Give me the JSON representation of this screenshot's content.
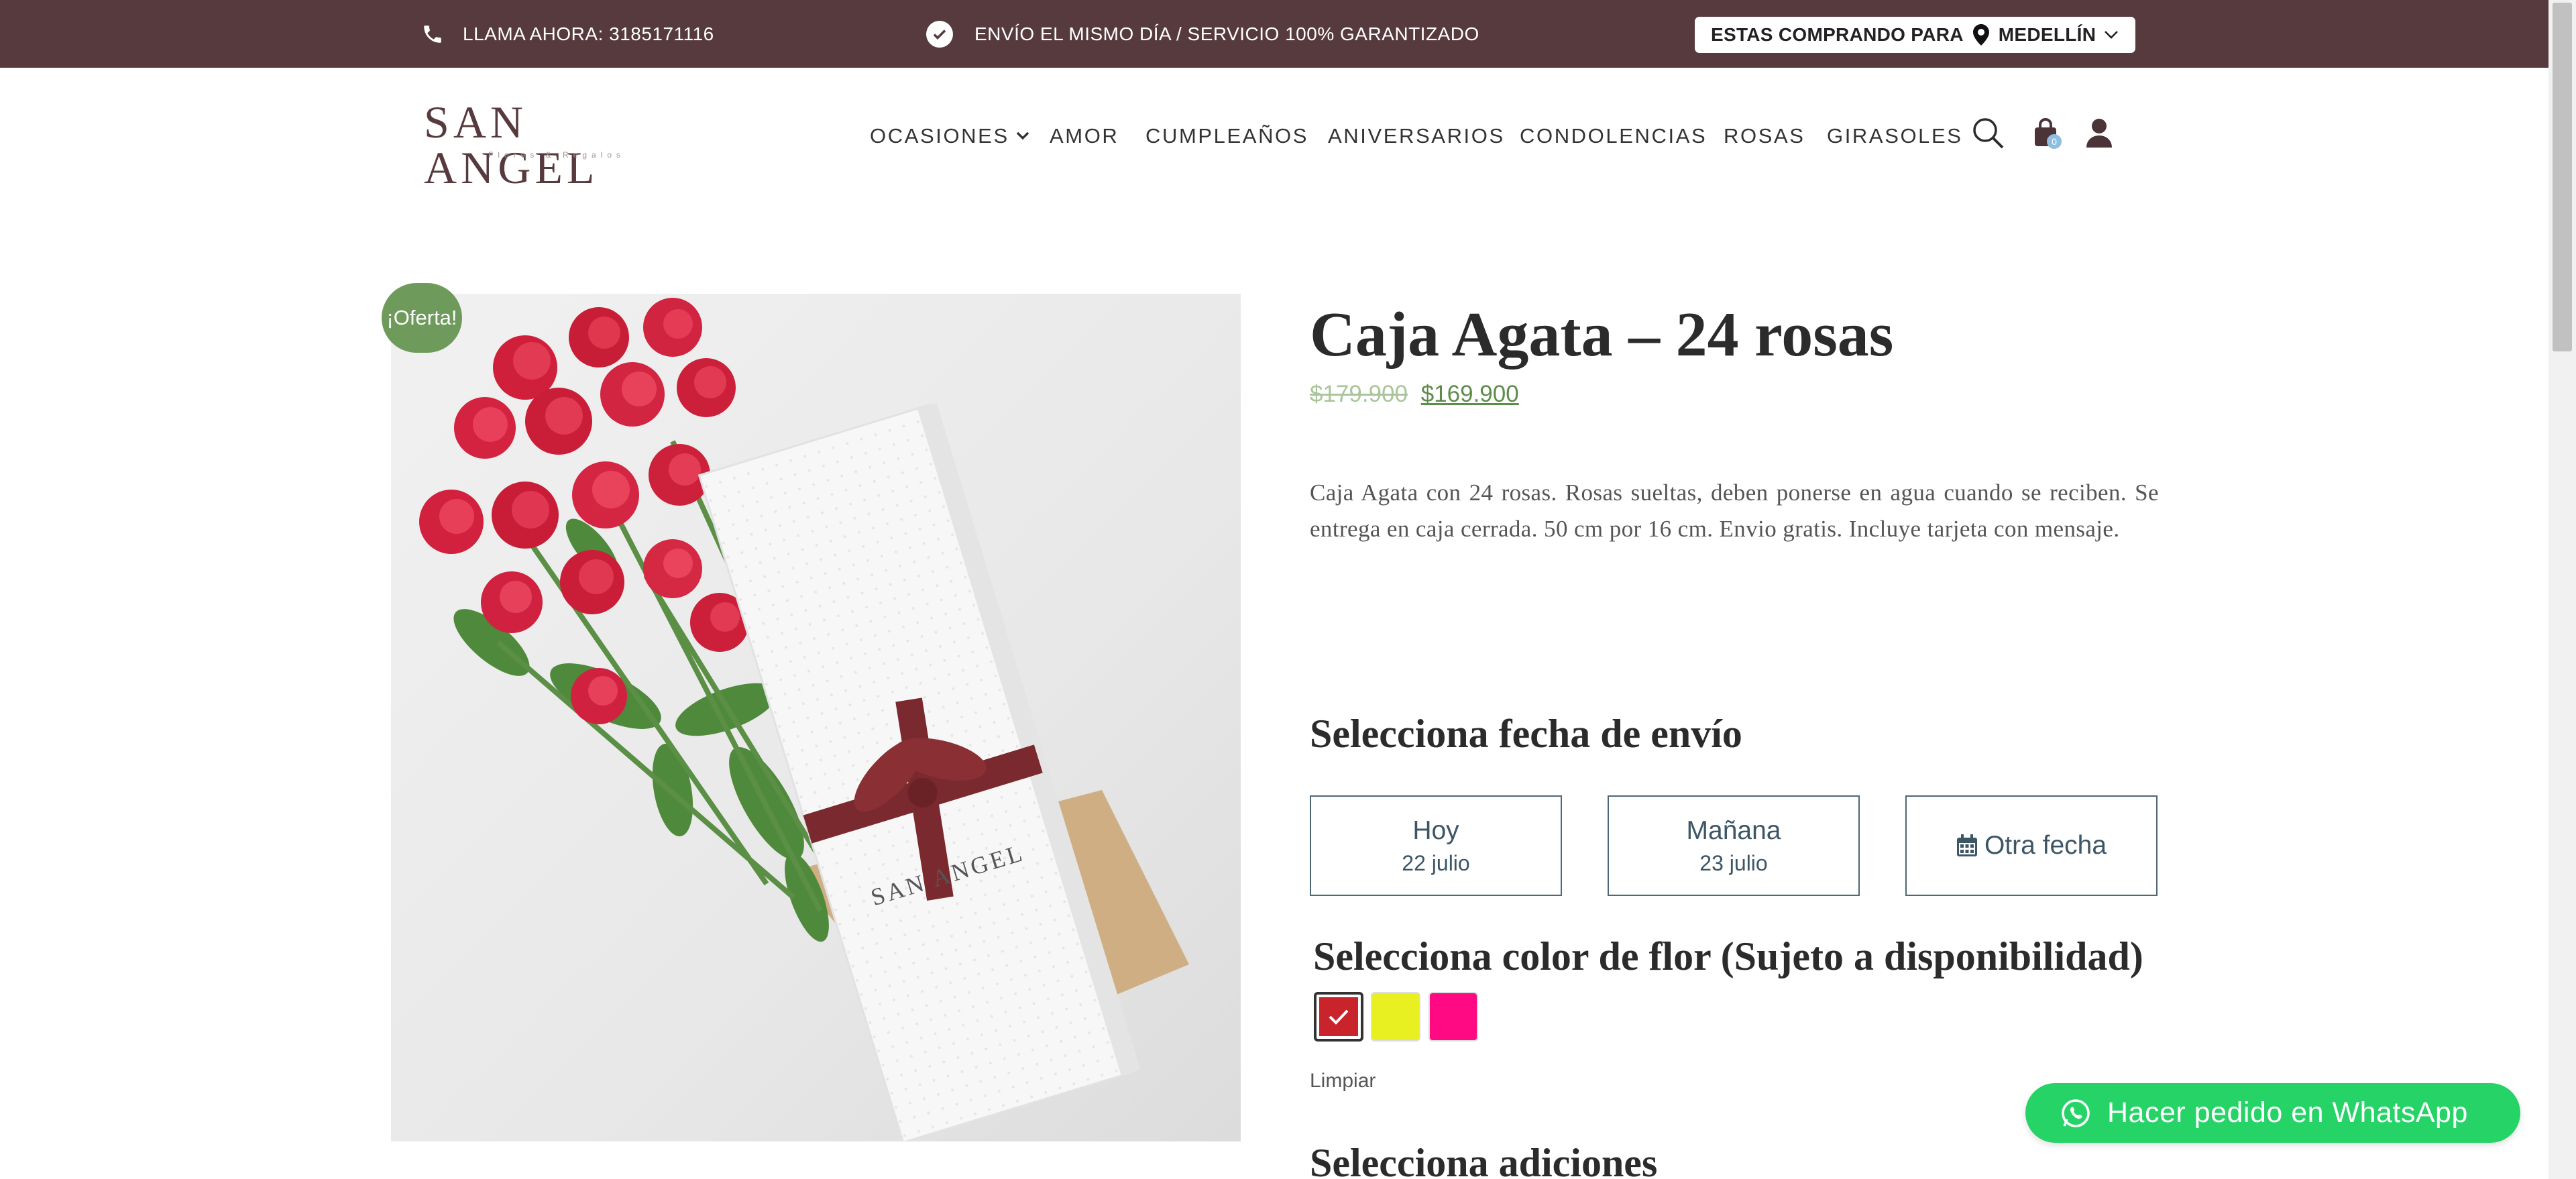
{
  "topbar": {
    "phone_text": "LLAMA AHORA: 3185171116",
    "shipping_text": "ENVÍO EL MISMO DÍA / SERVICIO 100% GARANTIZADO",
    "city_prefix": "ESTAS COMPRANDO PARA",
    "city": "MEDELLÍN",
    "bg_color": "#573A3D"
  },
  "header": {
    "logo_text": "SAN ANGEL",
    "logo_sub": "Flores & Regalos",
    "nav": [
      {
        "label": "OCASIONES"
      },
      {
        "label": "AMOR"
      },
      {
        "label": "CUMPLEAÑOS"
      },
      {
        "label": "ANIVERSARIOS"
      },
      {
        "label": "CONDOLENCIAS"
      },
      {
        "label": "ROSAS"
      },
      {
        "label": "GIRASOLES"
      }
    ],
    "cart_count": "0",
    "icons": [
      "search-icon",
      "shopping-bag-icon",
      "user-icon"
    ]
  },
  "product": {
    "sale_badge": "¡Oferta!",
    "title": "Caja Agata – 24 rosas",
    "old_price": "$179.900",
    "new_price": "$169.900",
    "description": "Caja Agata con 24 rosas. Rosas sueltas, deben ponerse en agua cuando se reciben. Se entrega en caja cerrada. 50 cm por 16 cm. Envio gratis. Incluye tarjeta con mensaje.",
    "box_brand": "SAN ANGEL"
  },
  "shipping_date": {
    "heading": "Selecciona fecha de envío",
    "options": [
      {
        "label": "Hoy",
        "date": "22 julio"
      },
      {
        "label": "Mañana",
        "date": "23 julio"
      },
      {
        "label": "Otra fecha"
      }
    ]
  },
  "flower_color": {
    "heading": "Selecciona color de flor (Sujeto a disponibilidad)",
    "swatches": [
      {
        "name": "rojo",
        "color": "#C9242B",
        "selected": true
      },
      {
        "name": "amarillo",
        "color": "#E8F021",
        "selected": false
      },
      {
        "name": "fucsia",
        "color": "#FF0A82",
        "selected": false
      }
    ],
    "clear_label": "Limpiar"
  },
  "additions": {
    "heading": "Selecciona adiciones"
  },
  "whatsapp": {
    "label": "Hacer pedido en WhatsApp",
    "color": "#25D366"
  }
}
